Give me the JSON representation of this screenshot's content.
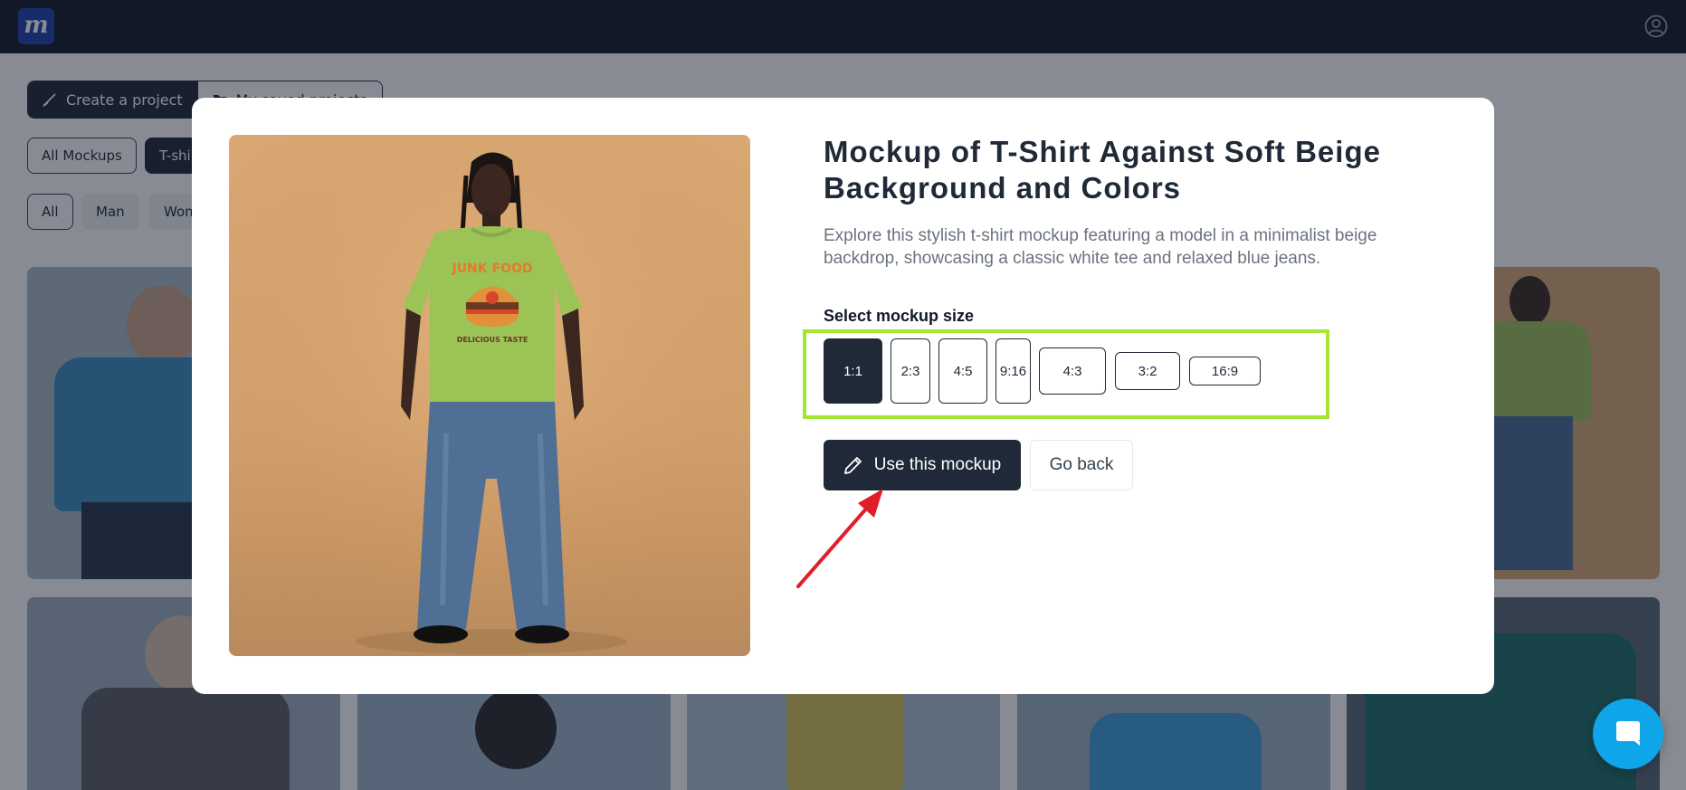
{
  "app": {
    "logo_letter": "m"
  },
  "background": {
    "tabs": {
      "create": "Create a project",
      "saved": "My saved projects"
    },
    "categories": [
      "All Mockups",
      "T-shirts"
    ],
    "filters": [
      "All",
      "Man",
      "Women"
    ]
  },
  "modal": {
    "title": "Mockup of T-Shirt Against Soft Beige Background and Colors",
    "description": "Explore this stylish t-shirt mockup featuring a model in a minimalist beige backdrop, showcasing a classic white tee and relaxed blue jeans.",
    "size_label": "Select mockup size",
    "sizes": [
      "1:1",
      "2:3",
      "4:5",
      "9:16",
      "4:3",
      "3:2",
      "16:9"
    ],
    "selected_size": "1:1",
    "use_button": "Use this mockup",
    "back_button": "Go back"
  },
  "colors": {
    "topbar": "#111827",
    "accent_dark": "#1f2937",
    "highlight": "#a3e635",
    "annotation_arrow": "#e11d2a",
    "chat": "#0ea5e9"
  }
}
